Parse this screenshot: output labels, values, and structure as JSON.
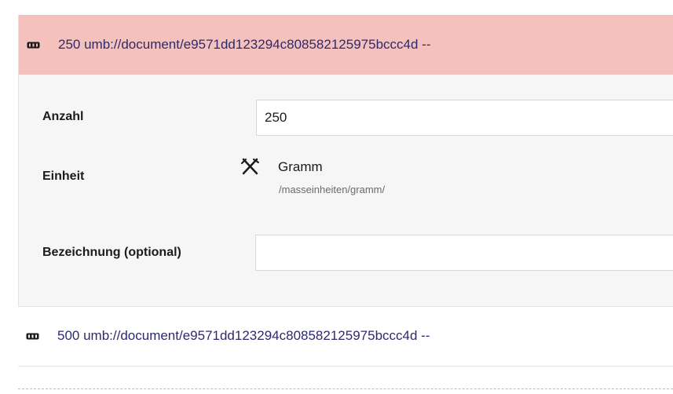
{
  "items": [
    {
      "title": "250 umb://document/e9571dd123294c808582125975bccc4d --",
      "icon": "block-icon"
    },
    {
      "title": "500 umb://document/e9571dd123294c808582125975bccc4d --",
      "icon": "block-icon"
    }
  ],
  "editor": {
    "anzahl": {
      "label": "Anzahl",
      "value": "250"
    },
    "einheit": {
      "label": "Einheit",
      "name": "Gramm",
      "path": "/masseinheiten/gramm/",
      "icon": "fork-knife-icon"
    },
    "bezeichnung": {
      "label": "Bezeichnung (optional)",
      "value": ""
    }
  },
  "colors": {
    "header_bg": "#f5c1bc",
    "panel_bg": "#f6f6f6",
    "link": "#2d2a6e"
  }
}
